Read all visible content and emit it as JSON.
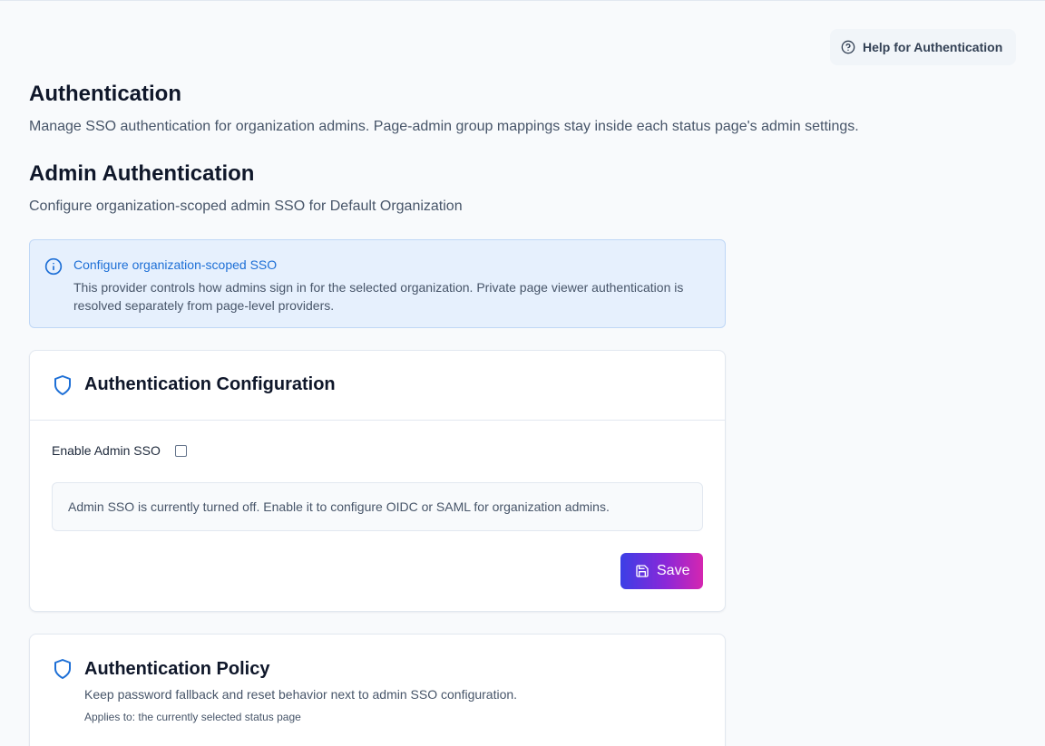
{
  "help": {
    "label": "Help for Authentication",
    "icon": "help-circle-icon"
  },
  "header": {
    "title": "Authentication",
    "subtitle": "Manage SSO authentication for organization admins. Page-admin group mappings stay inside each status page's admin settings."
  },
  "section": {
    "title": "Admin Authentication",
    "subtitle": "Configure organization-scoped admin SSO for Default Organization"
  },
  "info": {
    "title": "Configure organization-scoped SSO",
    "text": "This provider controls how admins sign in for the selected organization. Private page viewer authentication is resolved separately from page-level providers.",
    "icon": "info-icon"
  },
  "config_card": {
    "title": "Authentication Configuration",
    "icon": "shield-icon",
    "enable_label": "Enable Admin SSO",
    "enable_checked": false,
    "disabled_notice": "Admin SSO is currently turned off. Enable it to configure OIDC or SAML for organization admins.",
    "save_label": "Save",
    "save_icon": "save-icon"
  },
  "policy_card": {
    "title": "Authentication Policy",
    "icon": "shield-icon",
    "description": "Keep password fallback and reset behavior next to admin SSO configuration.",
    "note": "Applies to: the currently selected status page"
  },
  "colors": {
    "accent_blue": "#1d6fd6",
    "info_bg": "#e6f0fd",
    "save_gradient": [
      "#3b3fe6",
      "#8b27d8",
      "#d526b0"
    ]
  }
}
